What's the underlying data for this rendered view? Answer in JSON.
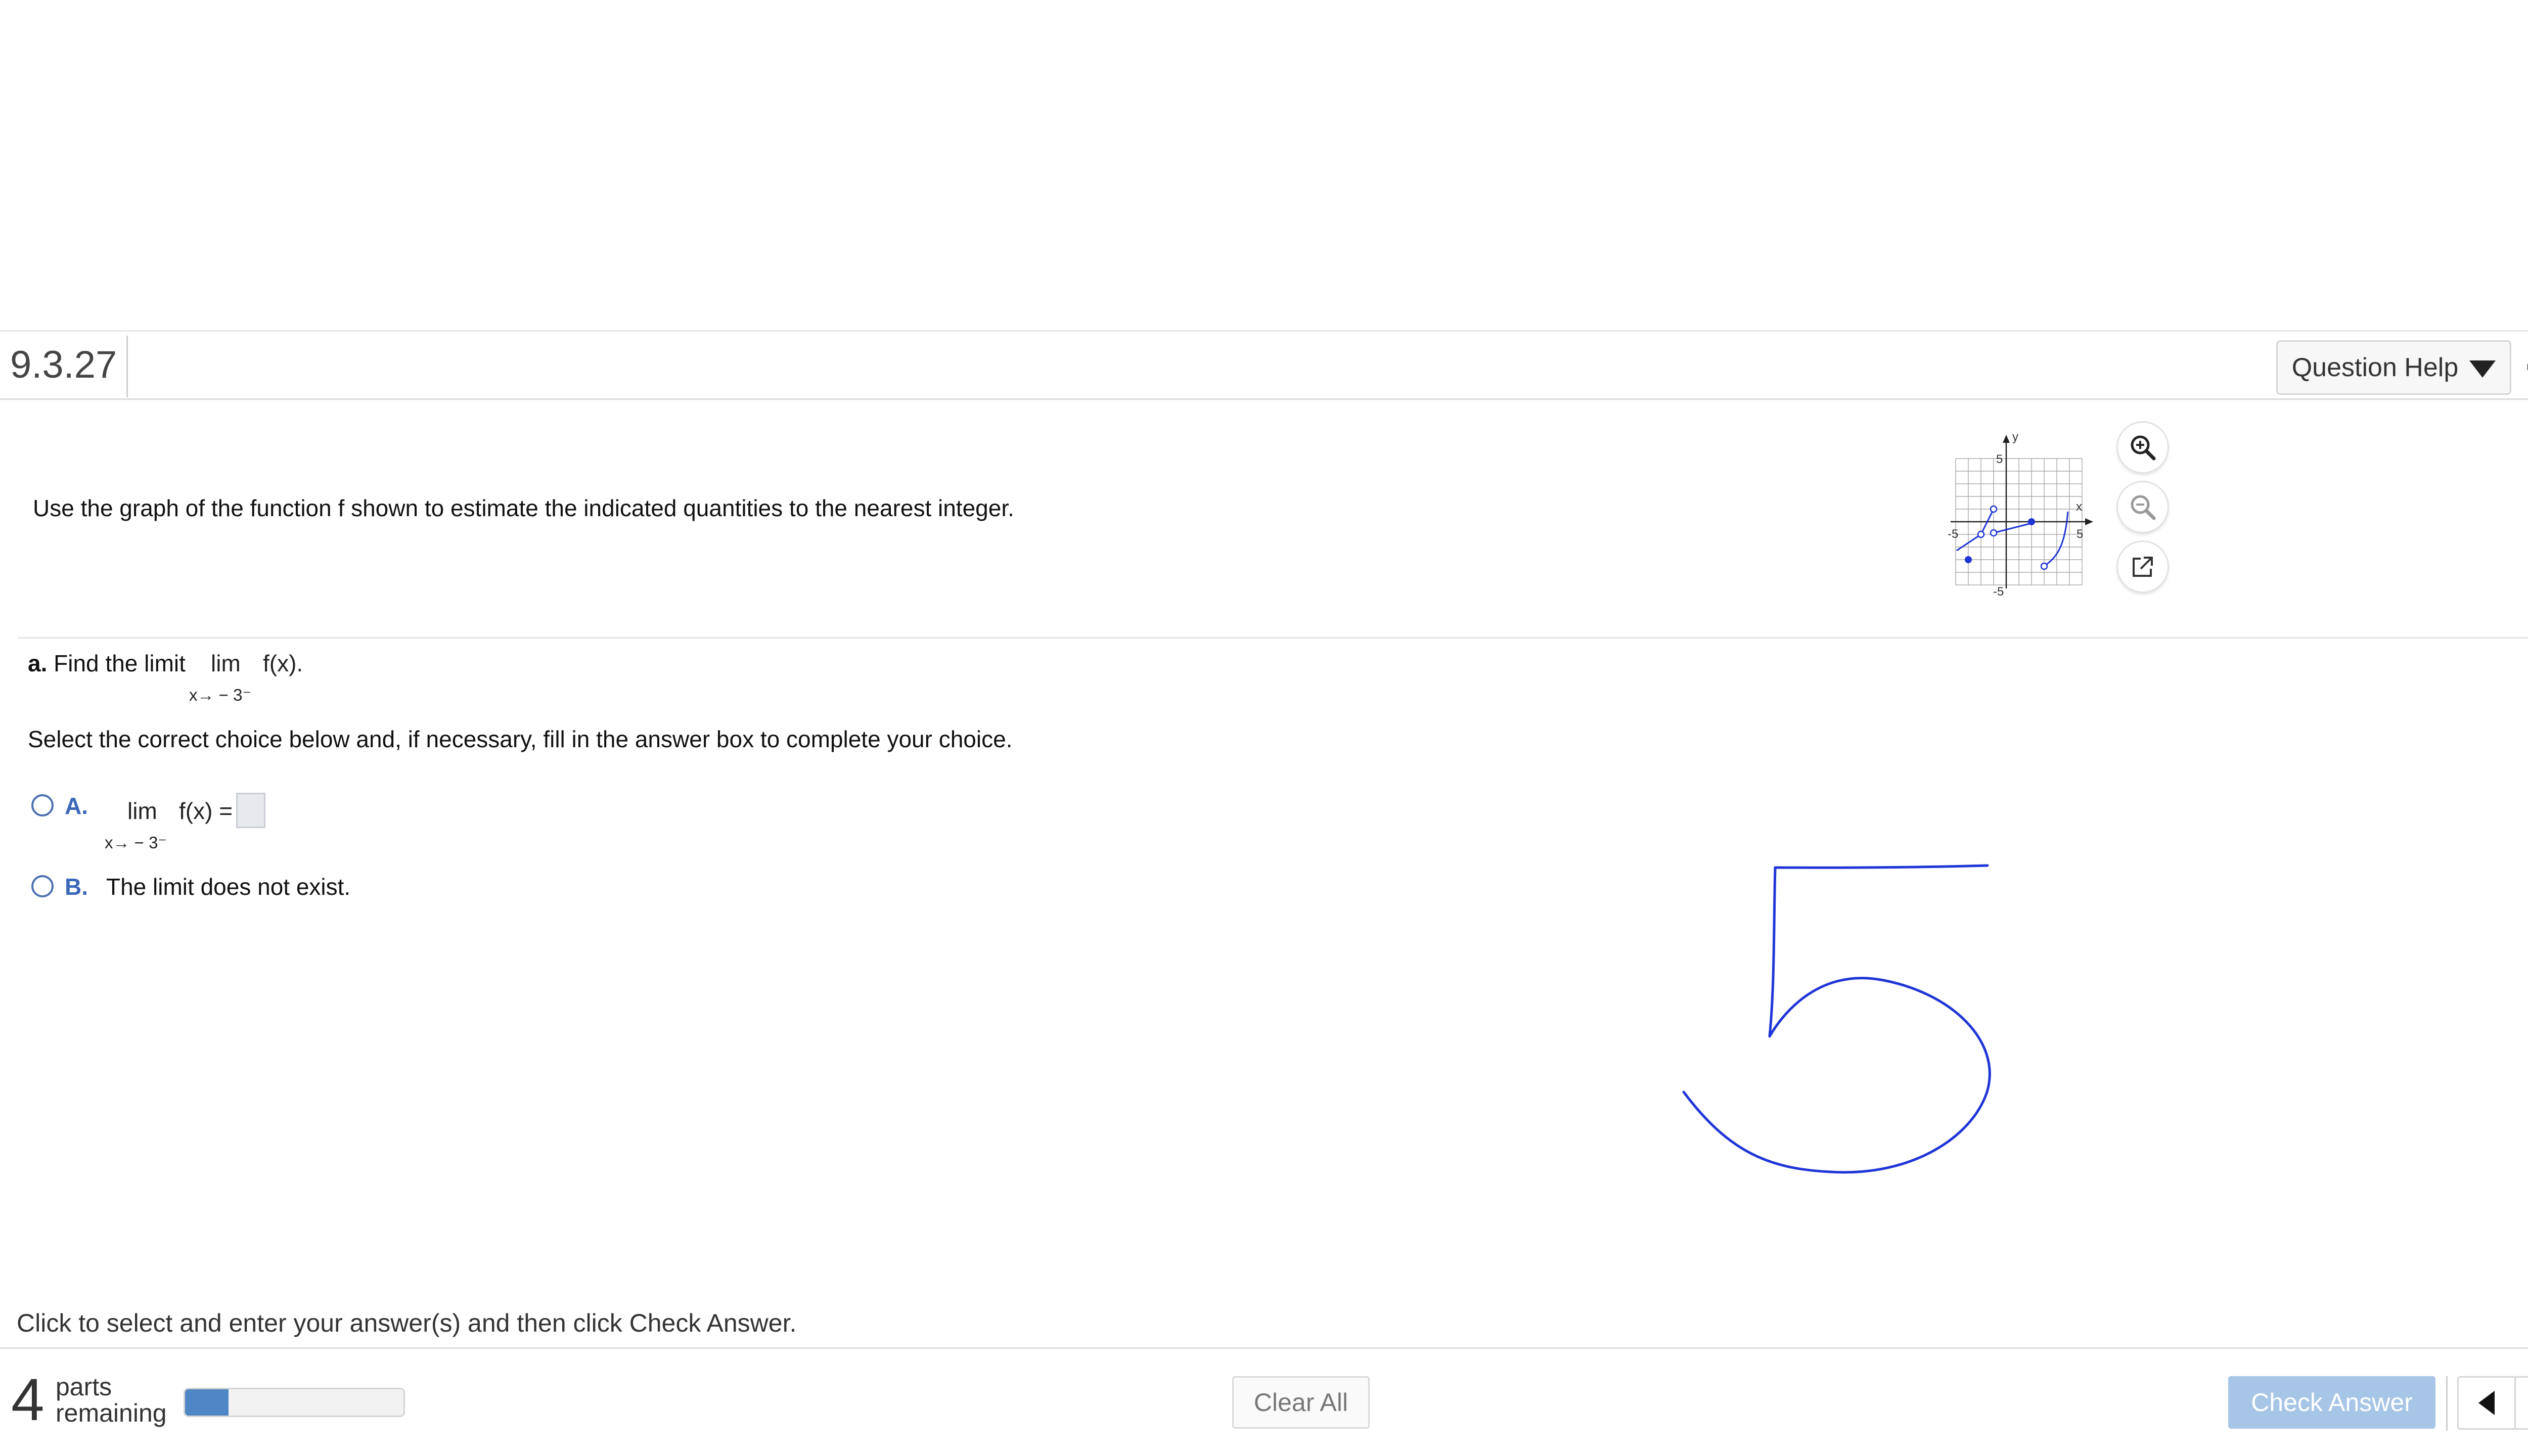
{
  "header": {
    "question_number": "9.3.27",
    "question_help_label": "Question Help",
    "icons": {
      "dropdown": "triangle-down-icon",
      "settings": "gear-icon"
    }
  },
  "problem": {
    "stem": "Use the graph of the function f shown to estimate the indicated quantities to the nearest integer.",
    "graph": {
      "y_label": "y",
      "x_label": "x",
      "tick_pos": "5",
      "tick_neg": "-5",
      "controls": [
        "zoom-in-icon",
        "zoom-out-icon",
        "popout-icon"
      ]
    }
  },
  "part_a": {
    "label": "a.",
    "prompt": "Find the limit",
    "lim": "lim",
    "fx": "f(x).",
    "subscript": "x→ − 3⁻",
    "instructions": "Select the correct choice below and, if necessary, fill in the answer box to complete your choice.",
    "choice_a": {
      "label": "A.",
      "lim": "lim",
      "fx": "f(x) =",
      "subscript": "x→ − 3⁻",
      "answer_value": ""
    },
    "choice_b": {
      "label": "B.",
      "text": "The limit does not exist."
    }
  },
  "annotation": {
    "handwritten_digit": "5",
    "color": "#1f35d6"
  },
  "footer": {
    "instruction": "Click to select and enter your answer(s) and then click Check Answer.",
    "help_symbol": "?",
    "parts_count": "4",
    "parts_word": "parts",
    "remaining_word": "remaining",
    "progress_fraction": 0.2,
    "clear_all_label": "Clear All",
    "check_answer_label": "Check Answer",
    "nav": [
      "previous-arrow-icon",
      "next-arrow-icon"
    ]
  },
  "colors": {
    "accent": "#3a67b8",
    "progress": "#4f86c6",
    "check_answer_bg": "#a7c5e6",
    "help_badge": "#f1c232",
    "graph_curve": "#1f35d6"
  }
}
